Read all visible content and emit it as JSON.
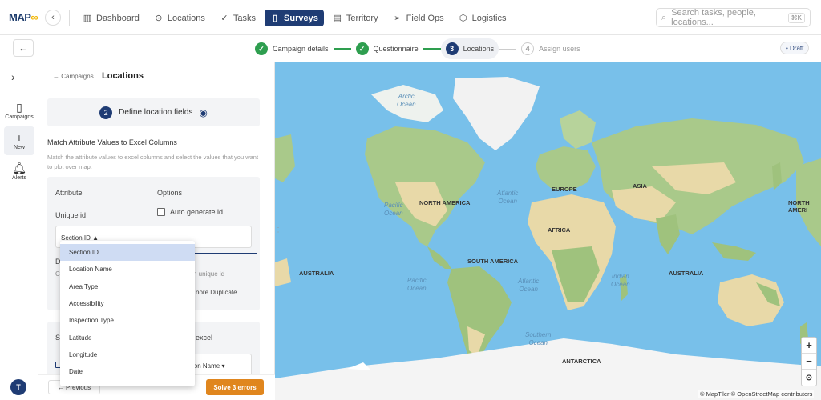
{
  "brand": {
    "logo_main": "MAP",
    "logo_accent": "∞"
  },
  "nav": {
    "items": [
      {
        "label": "Dashboard",
        "icon": "bar-chart-icon"
      },
      {
        "label": "Locations",
        "icon": "pin-icon"
      },
      {
        "label": "Tasks",
        "icon": "check-icon"
      },
      {
        "label": "Surveys",
        "icon": "clipboard-icon",
        "active": true
      },
      {
        "label": "Territory",
        "icon": "map-icon"
      },
      {
        "label": "Field Ops",
        "icon": "send-icon"
      },
      {
        "label": "Logistics",
        "icon": "box-icon"
      }
    ]
  },
  "search": {
    "placeholder": "Search tasks, people, locations...",
    "shortcut": "⌘K"
  },
  "stepper": {
    "steps": [
      {
        "num": "✓",
        "label": "Campaign details",
        "state": "done"
      },
      {
        "num": "✓",
        "label": "Questionnaire",
        "state": "done"
      },
      {
        "num": "3",
        "label": "Locations",
        "state": "current"
      },
      {
        "num": "4",
        "label": "Assign users",
        "state": "todo"
      }
    ],
    "status": "• Draft"
  },
  "rail": {
    "items": [
      {
        "label": "Campaigns",
        "icon": "clipboard-icon"
      },
      {
        "label": "New",
        "icon": "plus-icon"
      },
      {
        "label": "Alerts",
        "icon": "bell-icon"
      }
    ],
    "avatar": "T"
  },
  "panel": {
    "breadcrumb": "← Campaigns",
    "title": "Locations",
    "step_num": "2",
    "step_label": "Define location fields",
    "section_title": "Match Attribute Values to Excel Columns",
    "section_desc": "Match the attribute values to excel columns and select the values that you want to plot over map.",
    "col_attribute": "Attribute",
    "col_options": "Options",
    "unique_id_label": "Unique id",
    "auto_generate_label": "Auto generate id",
    "selected_value": "Section ID ▲",
    "partial_d": "D",
    "partial_c": "Ch",
    "partial_unique": "n unique id",
    "partial_ignore": "nore Duplicate",
    "partial_se": "Se",
    "partial_excel": "excel",
    "partial_ion": "ion Name ▾",
    "prev_button": "← Previous",
    "errors_button": "Solve 3 errors"
  },
  "dropdown": {
    "options": [
      "Section ID",
      "Location Name",
      "Area Type",
      "Accessibility",
      "Inspection Type",
      "Latitude",
      "Longitude",
      "Date"
    ],
    "selected_index": 0
  },
  "map": {
    "labels": {
      "arctic": "Arctic\nOcean",
      "pacific_n": "Pacific\nOcean",
      "atlantic_n": "Atlantic\nOcean",
      "pacific_s": "Pacific\nOcean",
      "atlantic_s": "Atlantic\nOcean",
      "indian": "Indian\nOcean",
      "southern": "Southern\nOcean",
      "north_america": "NORTH AMERICA",
      "north_america_r": "NORTH AMERI",
      "south_america": "SOUTH AMERICA",
      "europe": "EUROPE",
      "asia": "ASIA",
      "africa": "AFRICA",
      "australia_l": "AUSTRALIA",
      "australia_r": "AUSTRALIA",
      "antarctica": "ANTARCTICA"
    },
    "zoom_in": "+",
    "zoom_out": "−",
    "reset": "⊙",
    "attribution": "© MapTiler © OpenStreetMap contributors"
  }
}
